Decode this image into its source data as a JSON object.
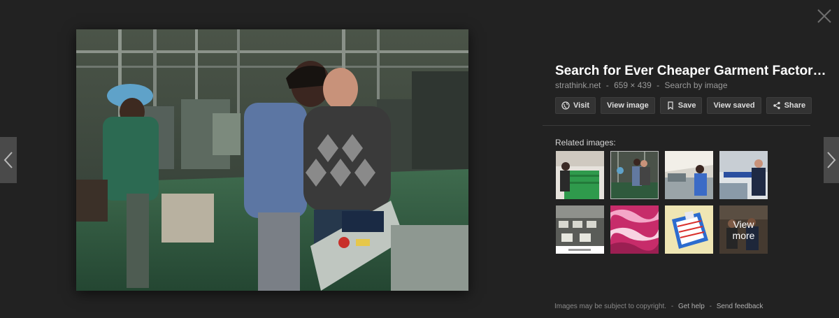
{
  "viewer": {
    "title": "Search for Ever Cheaper Garment Factor…",
    "source_site": "strathink.net",
    "dimensions": "659 × 439",
    "separator": "-",
    "search_by_image": "Search by image"
  },
  "actions": {
    "visit": "Visit",
    "view_image": "View image",
    "save": "Save",
    "view_saved": "View saved",
    "share": "Share"
  },
  "related": {
    "label": "Related images:",
    "view_more": "View more"
  },
  "footer": {
    "notice": "Images may be subject to copyright.",
    "separator": "-",
    "get_help": "Get help",
    "send_feedback": "Send feedback"
  },
  "colors": {
    "background": "#222222",
    "button_bg": "#333333",
    "text_muted": "#9a9a9a"
  },
  "icons": {
    "close": "close-icon",
    "prev": "chevron-left-icon",
    "next": "chevron-right-icon",
    "visit": "globe-icon",
    "save": "bookmark-icon",
    "share": "share-icon"
  }
}
